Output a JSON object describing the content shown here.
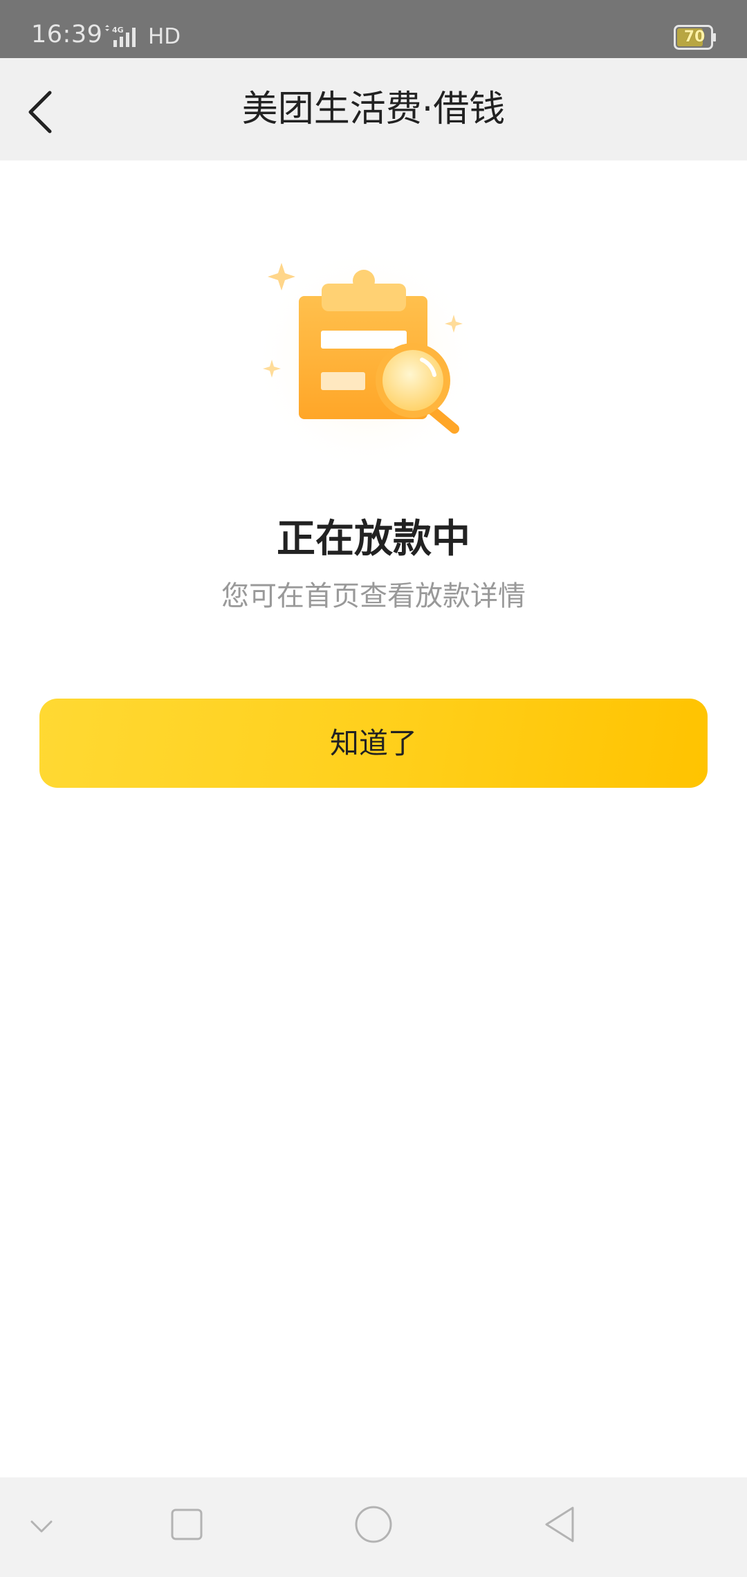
{
  "status_bar": {
    "time": "16:39",
    "network": "HD",
    "battery": "70",
    "signal_icon": "4g-signal-icon"
  },
  "header": {
    "title": "美团生活费·借钱",
    "back_icon": "chevron-left-icon"
  },
  "result": {
    "illustration_icon": "clipboard-search-icon",
    "title": "正在放款中",
    "subtitle": "您可在首页查看放款详情"
  },
  "actions": {
    "confirm_label": "知道了",
    "confirm_color_start": "#ffd933",
    "confirm_color_end": "#ffc300"
  },
  "system_nav": {
    "items": [
      "chevron-down-icon",
      "square-icon",
      "circle-icon",
      "triangle-back-icon"
    ]
  }
}
